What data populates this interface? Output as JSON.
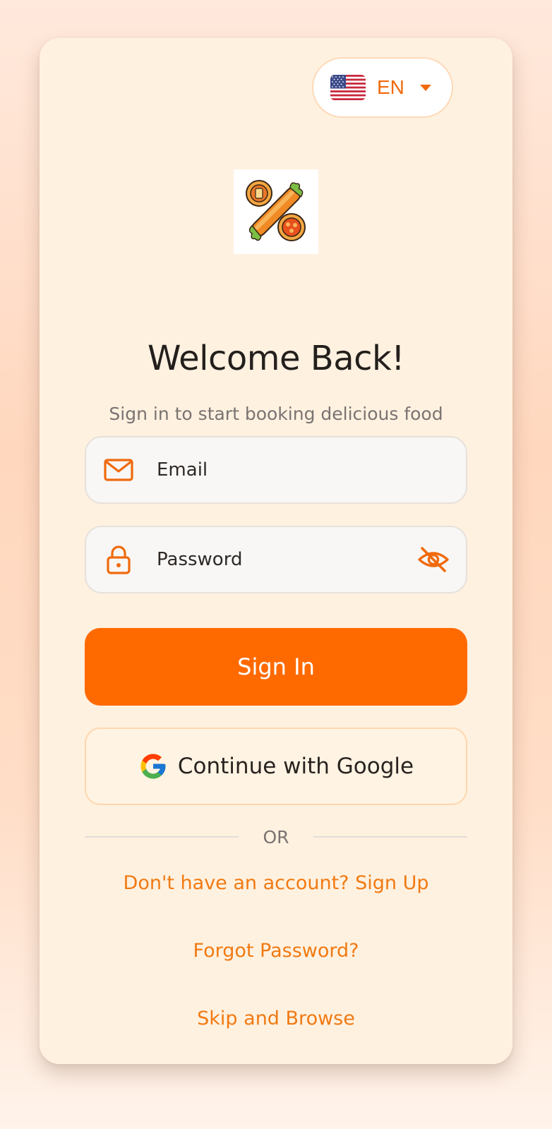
{
  "language": {
    "code": "EN",
    "flag_icon": "us-flag-icon",
    "caret_icon": "caret-down-icon"
  },
  "logo": {
    "icon": "food-discount-logo-icon"
  },
  "header": {
    "title": "Welcome Back!",
    "subtitle": "Sign in to start booking delicious food"
  },
  "form": {
    "email": {
      "placeholder": "Email",
      "value": "",
      "icon": "mail-icon"
    },
    "password": {
      "placeholder": "Password",
      "value": "",
      "icon": "lock-icon",
      "toggle_icon": "eye-off-icon"
    }
  },
  "actions": {
    "sign_in_label": "Sign In",
    "google_label": "Continue with Google",
    "google_icon": "google-icon",
    "divider_label": "OR",
    "sign_up_link": "Don't have an account? Sign Up",
    "forgot_password_link": "Forgot Password?",
    "skip_link": "Skip and Browse"
  },
  "colors": {
    "accent": "#FF6A00",
    "link": "#F07A12",
    "card_background": "#FFF1E0",
    "title_text": "#231F1C",
    "muted_text": "#797371"
  }
}
